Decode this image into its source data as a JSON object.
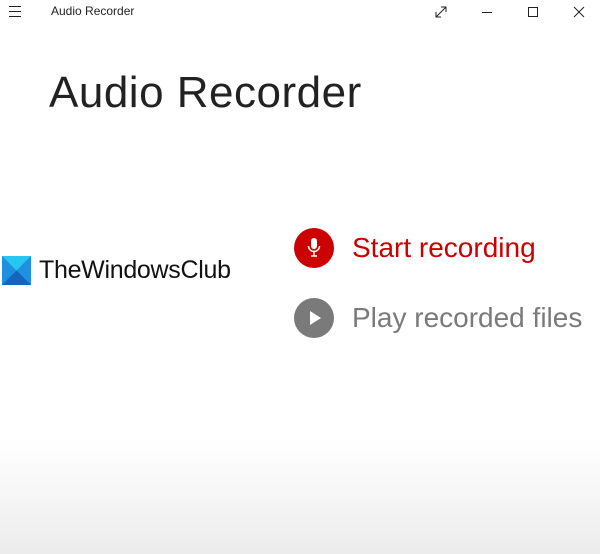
{
  "window": {
    "title": "Audio Recorder",
    "icons": [
      "hamburger-menu-icon",
      "fullscreen-icon",
      "minimize-icon",
      "maximize-icon",
      "close-icon"
    ]
  },
  "app": {
    "heading": "Audio Recorder"
  },
  "actions": [
    {
      "label": "Start recording",
      "icon": "microphone-icon",
      "color": "#cc0000"
    },
    {
      "label": "Play recorded files",
      "icon": "play-icon",
      "color": "#7a7a7a"
    }
  ],
  "watermark": {
    "text": "TheWindowsClub"
  }
}
